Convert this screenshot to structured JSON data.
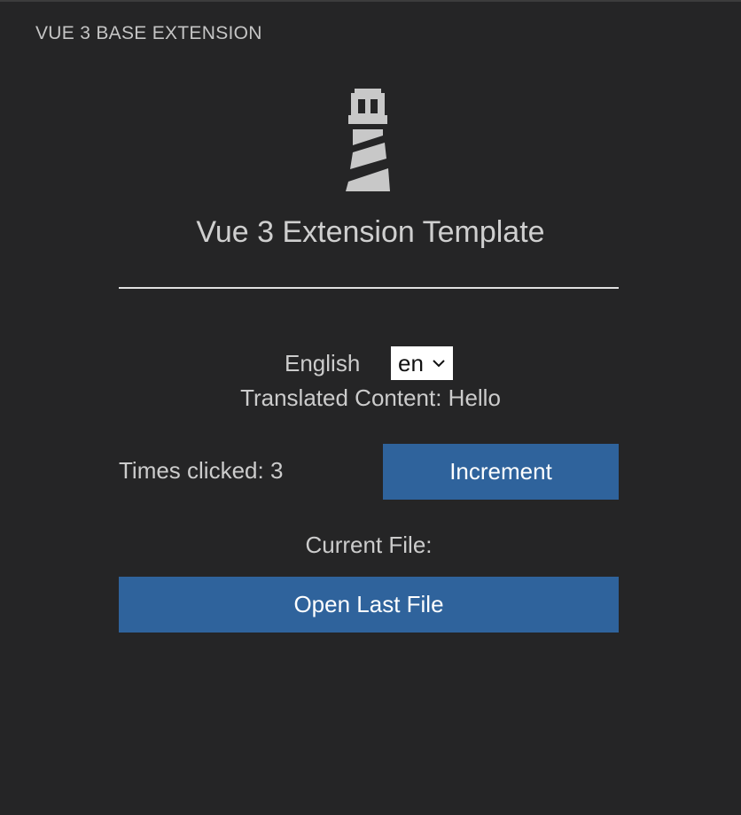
{
  "panel": {
    "title": "VUE 3 BASE EXTENSION"
  },
  "app": {
    "logo_icon": "lighthouse-icon",
    "title": "Vue 3 Extension Template"
  },
  "language": {
    "label": "English",
    "selected": "en"
  },
  "translated": {
    "text": "Translated Content: Hello"
  },
  "counter": {
    "text": "Times clicked: 3",
    "button_label": "Increment"
  },
  "file": {
    "current_label": "Current File:",
    "open_button_label": "Open Last File"
  },
  "colors": {
    "background": "#252526",
    "button": "#2f639c",
    "text": "#cccccc"
  }
}
